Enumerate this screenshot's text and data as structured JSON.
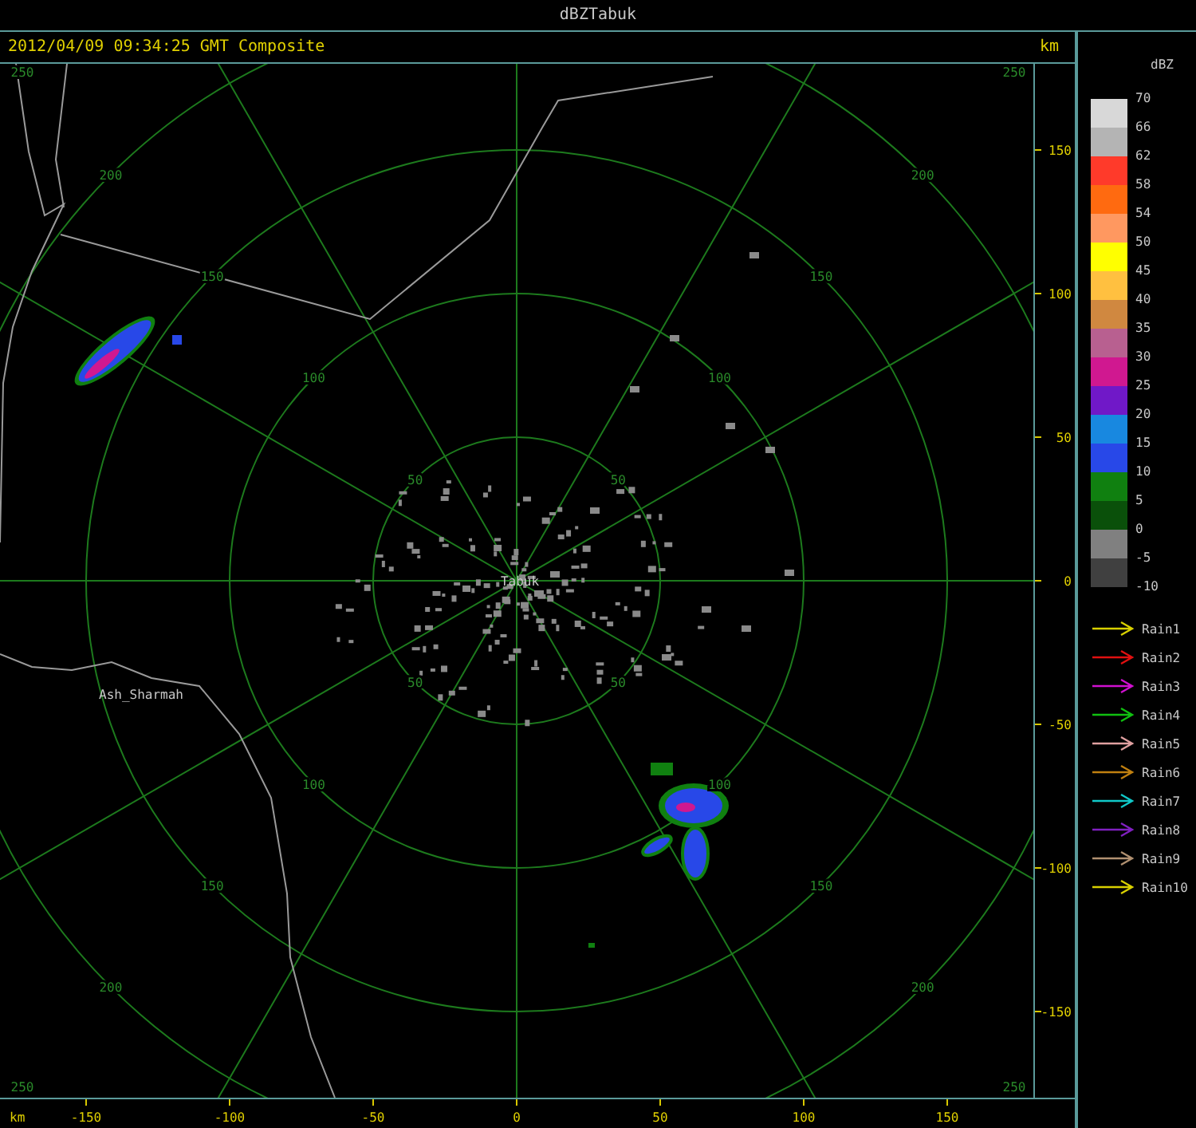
{
  "window": {
    "title": "dBZTabuk"
  },
  "header": {
    "timestamp": "2012/04/09 09:34:25 GMT Composite"
  },
  "plot": {
    "rings": [
      {
        "labels": [
          "50",
          "50",
          "50",
          "50"
        ]
      },
      {
        "labels": [
          "100",
          "100",
          "100",
          "100"
        ]
      },
      {
        "labels": [
          "150",
          "150",
          "150",
          "150"
        ]
      },
      {
        "labels": [
          "200",
          "200",
          "200",
          "200"
        ]
      }
    ],
    "corner_labels": [
      "250",
      "250",
      "250",
      "250"
    ],
    "places": [
      {
        "name": "Tabuk"
      },
      {
        "name": "Ash_Sharmah"
      }
    ]
  },
  "y_axis": {
    "unit": "km",
    "ticks": [
      "150",
      "100",
      "50",
      "0",
      "-50",
      "-100",
      "-150"
    ]
  },
  "x_axis": {
    "unit": "km",
    "ticks": [
      "-150",
      "-100",
      "-50",
      "0",
      "50",
      "100",
      "150"
    ]
  },
  "legend": {
    "title": "dBZ",
    "bins": [
      {
        "color": "#d8d8d8"
      },
      {
        "color": "#b4b4b4"
      },
      {
        "color": "#ff3a2a"
      },
      {
        "color": "#ff6a10"
      },
      {
        "color": "#ff9860"
      },
      {
        "color": "#ffff00"
      },
      {
        "color": "#ffc040"
      },
      {
        "color": "#d08840"
      },
      {
        "color": "#b86090"
      },
      {
        "color": "#d01890"
      },
      {
        "color": "#7018c8"
      },
      {
        "color": "#1888e0"
      },
      {
        "color": "#2848e8"
      },
      {
        "color": "#108010"
      },
      {
        "color": "#0a500a"
      },
      {
        "color": "#808080"
      },
      {
        "color": "#404040"
      }
    ],
    "ticks": [
      "70",
      "66",
      "62",
      "58",
      "54",
      "50",
      "45",
      "40",
      "35",
      "30",
      "25",
      "20",
      "15",
      "10",
      "5",
      "0",
      "-5",
      "-10"
    ]
  },
  "tracks": [
    {
      "label": "Rain1",
      "color": "#d8d000"
    },
    {
      "label": "Rain2",
      "color": "#e01010"
    },
    {
      "label": "Rain3",
      "color": "#d010d0"
    },
    {
      "label": "Rain4",
      "color": "#10c010"
    },
    {
      "label": "Rain5",
      "color": "#e0a0a0"
    },
    {
      "label": "Rain6",
      "color": "#c08010"
    },
    {
      "label": "Rain7",
      "color": "#10c8c8"
    },
    {
      "label": "Rain8",
      "color": "#8020c0"
    },
    {
      "label": "Rain9",
      "color": "#b09070"
    },
    {
      "label": "Rain10",
      "color": "#d8d000"
    }
  ]
}
